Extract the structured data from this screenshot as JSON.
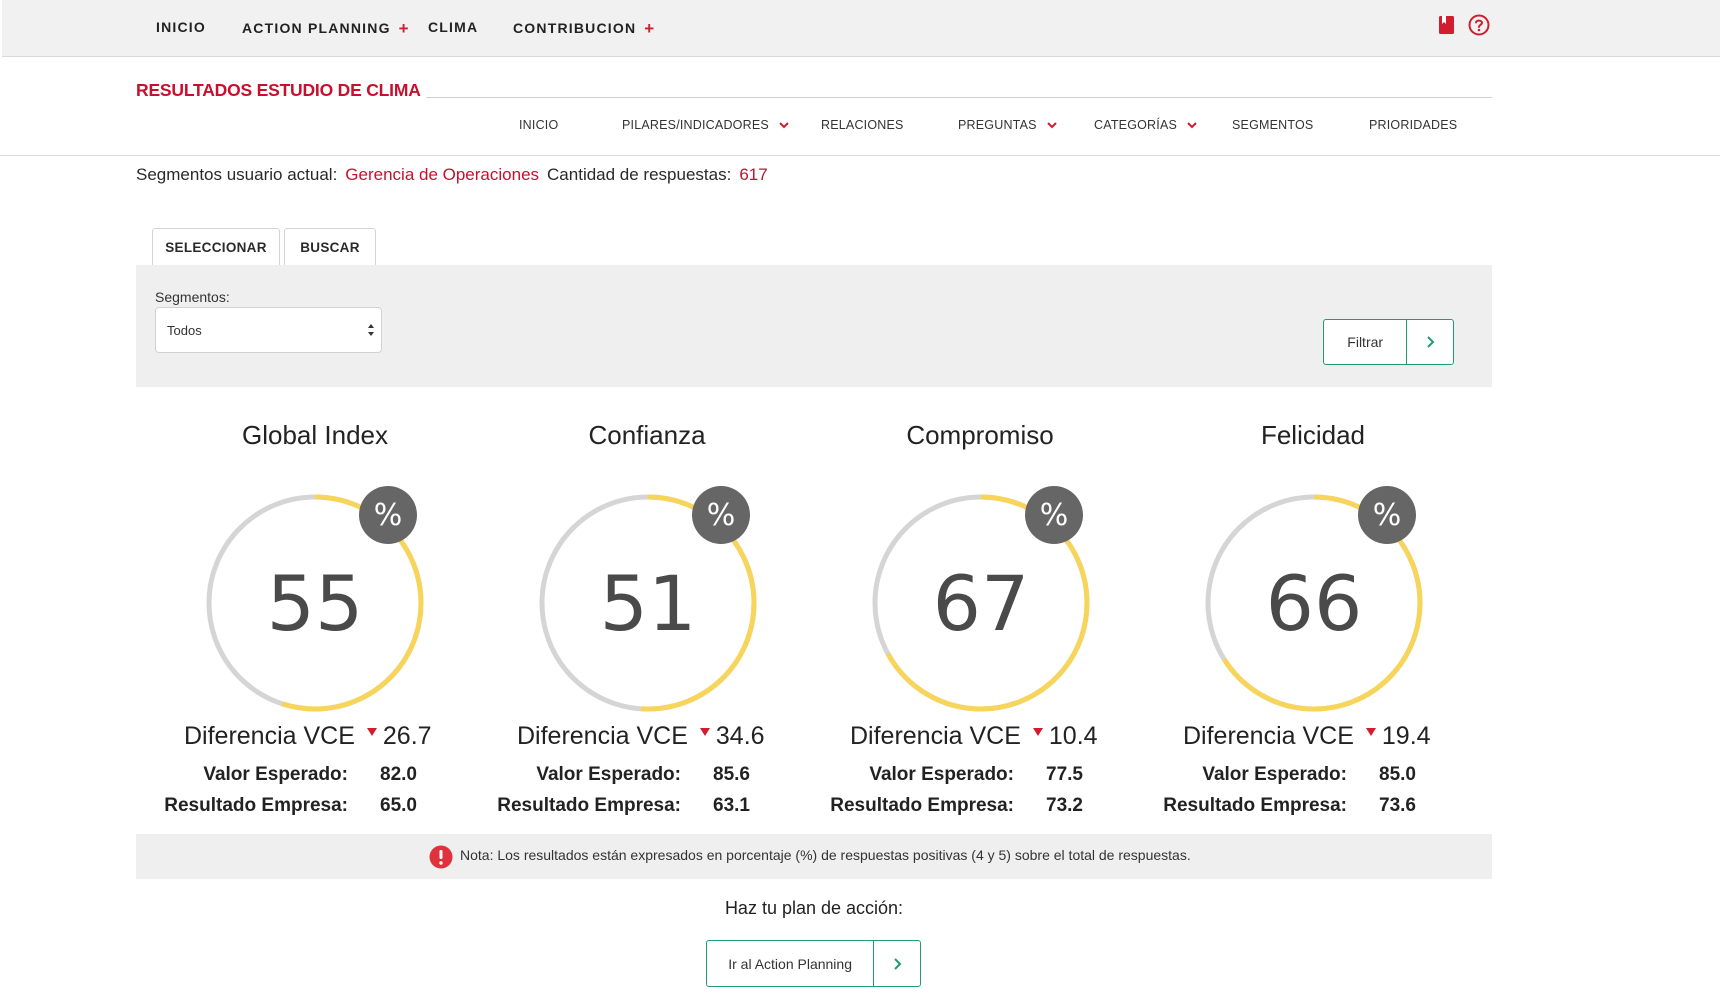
{
  "topnav": {
    "items": [
      {
        "label": "INICIO",
        "has_plus": false
      },
      {
        "label": "ACTION PLANNING",
        "has_plus": true
      },
      {
        "label": "CLIMA",
        "has_plus": false
      },
      {
        "label": "CONTRIBUCION",
        "has_plus": true
      }
    ],
    "plus_glyph": "+",
    "icons": [
      "book-icon",
      "help-circle-icon"
    ]
  },
  "header": {
    "title": "RESULTADOS ESTUDIO DE CLIMA",
    "subnav": [
      {
        "label": "INICIO",
        "dropdown": false
      },
      {
        "label": "PILARES/INDICADORES",
        "dropdown": true
      },
      {
        "label": "RELACIONES",
        "dropdown": false
      },
      {
        "label": "PREGUNTAS",
        "dropdown": true
      },
      {
        "label": "CATEGORÍAS",
        "dropdown": true
      },
      {
        "label": "SEGMENTOS",
        "dropdown": false
      },
      {
        "label": "PRIORIDADES",
        "dropdown": false
      }
    ]
  },
  "info": {
    "segment_label": "Segmentos usuario actual:",
    "segment_value": "Gerencia de Operaciones",
    "count_label": "Cantidad de respuestas:",
    "count_value": "617"
  },
  "filter": {
    "tabs": [
      "SELECCIONAR",
      "BUSCAR"
    ],
    "segment_field_label": "Segmentos:",
    "segment_value": "Todos",
    "filter_button": "Filtrar"
  },
  "gauges": [
    {
      "title": "Global Index",
      "value": "55",
      "percent": 55,
      "diff_label": "Diferencia VCE",
      "diff_value": "26.7",
      "expected_label": "Valor Esperado:",
      "expected_value": "82.0",
      "company_label": "Resultado Empresa:",
      "company_value": "65.0"
    },
    {
      "title": "Confianza",
      "value": "51",
      "percent": 51,
      "diff_label": "Diferencia VCE",
      "diff_value": "34.6",
      "expected_label": "Valor Esperado:",
      "expected_value": "85.6",
      "company_label": "Resultado Empresa:",
      "company_value": "63.1"
    },
    {
      "title": "Compromiso",
      "value": "67",
      "percent": 67,
      "diff_label": "Diferencia VCE",
      "diff_value": "10.4",
      "expected_label": "Valor Esperado:",
      "expected_value": "77.5",
      "company_label": "Resultado Empresa:",
      "company_value": "73.2"
    },
    {
      "title": "Felicidad",
      "value": "66",
      "percent": 66,
      "diff_label": "Diferencia VCE",
      "diff_value": "19.4",
      "expected_label": "Valor Esperado:",
      "expected_value": "85.0",
      "company_label": "Resultado Empresa:",
      "company_value": "73.6"
    }
  ],
  "badge_symbol": "%",
  "note": {
    "icon": "alert-circle-icon",
    "text": "Nota: Los resultados están expresados en porcentaje (%) de respuestas positivas (4 y 5) sobre el total de respuestas."
  },
  "cta": {
    "text": "Haz tu plan de acción:",
    "button": "Ir al Action Planning"
  },
  "colors": {
    "brand_red": "#c8102e",
    "gauge_fill": "#f7d45a",
    "gauge_track": "#d5d5d5",
    "badge": "#666666",
    "button_green": "#1f9d6e"
  }
}
